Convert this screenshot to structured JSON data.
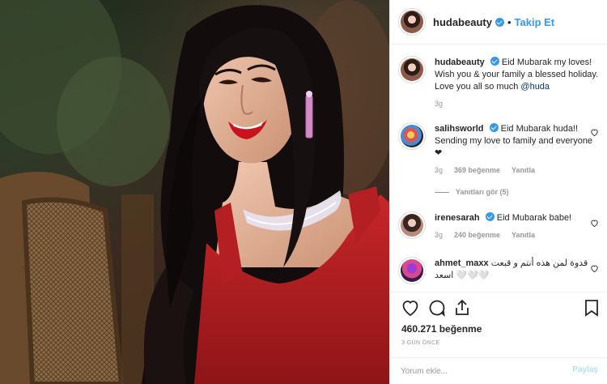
{
  "photo": {
    "alt": ""
  },
  "header": {
    "username": "hudabeauty",
    "separator": "•",
    "follow_label": "Takip Et"
  },
  "comments": [
    {
      "username": "hudabeauty",
      "verified": true,
      "text": "Eid Mubarak my loves! Wish you & your family a blessed holiday. Love you all so much",
      "mention": "@huda",
      "time": "3g"
    },
    {
      "username": "salihsworld",
      "verified": true,
      "text": "Eid Mubarak huda!! Sending my love to family and everyone ❤",
      "time": "3g",
      "likes": "369 beğenme",
      "reply_label": "Yanıtla",
      "replies_label": "Yanıtları gör (5)"
    },
    {
      "username": "irenesarah",
      "verified": true,
      "text": "Eid Mubarak babe!",
      "time": "3g",
      "likes": "240 beğenme",
      "reply_label": "Yanıtla"
    },
    {
      "username": "ahmet_maxx",
      "verified": false,
      "text": "قدوة لمن هذه أنتم و قبعت اسعد 🤍🤍🤍",
      "time": ""
    }
  ],
  "actions": {
    "like_count": "460.271 beğenme",
    "posted_time": "3 GÜN ÖNCE",
    "comment_placeholder": "Yorum ekle...",
    "post_label": "Paylaş"
  },
  "colors": {
    "accent": "#3897f0",
    "text": "#262626",
    "muted": "#999999",
    "border": "#efefef"
  }
}
